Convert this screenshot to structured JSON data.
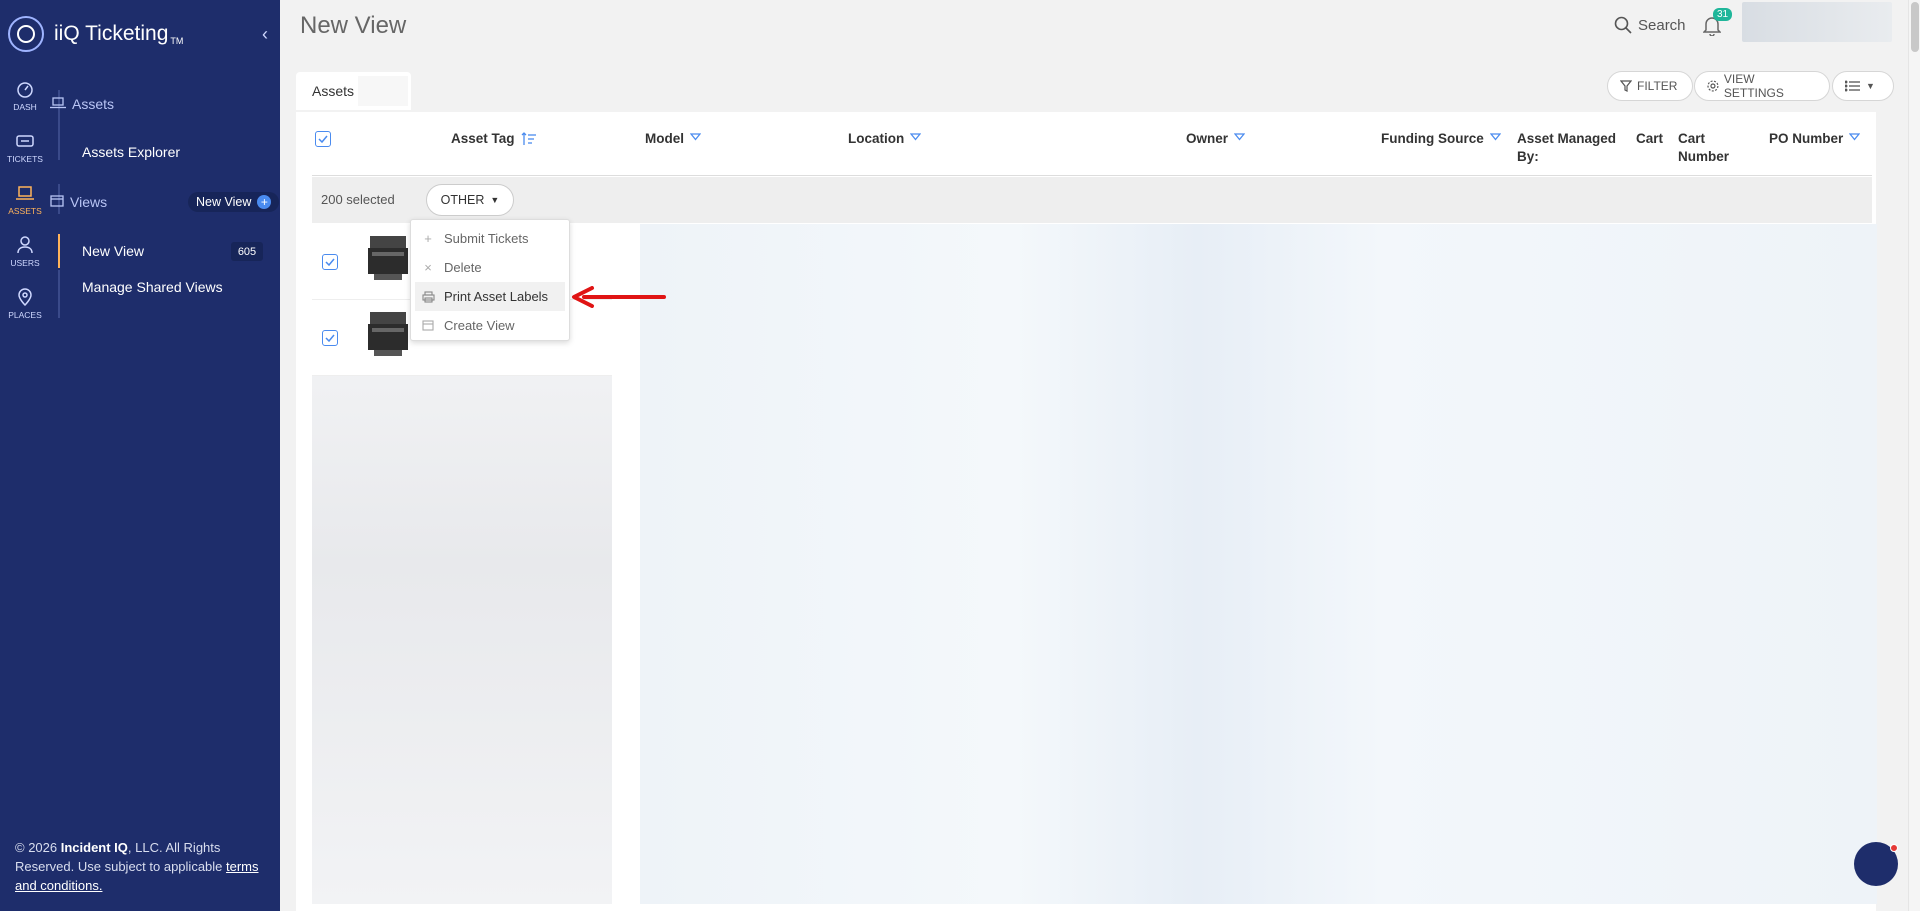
{
  "app": {
    "title": "iiQ Ticketing",
    "tm": "TM"
  },
  "rail": [
    {
      "label": "DASH",
      "icon": "dashboard-icon"
    },
    {
      "label": "TICKETS",
      "icon": "ticket-icon"
    },
    {
      "label": "ASSETS",
      "icon": "laptop-icon"
    },
    {
      "label": "USERS",
      "icon": "user-icon"
    },
    {
      "label": "PLACES",
      "icon": "location-pin-icon"
    }
  ],
  "nav": {
    "assets_section": "Assets",
    "assets_explorer": "Assets Explorer",
    "views_section": "Views",
    "new_view_badge": "New View",
    "new_view_link": "New View",
    "new_view_count": "605",
    "manage_shared": "Manage Shared Views"
  },
  "footer": {
    "pre": "© 2026 ",
    "company": "Incident IQ",
    "post": ", LLC. All Rights Reserved. Use subject to applicable ",
    "terms": "terms and conditions."
  },
  "header": {
    "title": "New View",
    "search": "Search",
    "notifications": "31"
  },
  "tab": {
    "label": "Assets"
  },
  "toolbar": {
    "filter": "FILTER",
    "view_settings": "VIEW SETTINGS"
  },
  "columns": {
    "asset_tag": "Asset Tag",
    "model": "Model",
    "location": "Location",
    "owner": "Owner",
    "funding": "Funding Source",
    "managed_by_1": "Asset Managed",
    "managed_by_2": "By:",
    "cart": "Cart",
    "cart_number_1": "Cart",
    "cart_number_2": "Number",
    "po_number": "PO Number"
  },
  "selection": {
    "text": "200 selected",
    "other": "OTHER"
  },
  "menu": {
    "submit": "Submit Tickets",
    "delete": "Delete",
    "print": "Print Asset Labels",
    "create": "Create View"
  },
  "colors": {
    "sidebar": "#1e2d6b",
    "accent": "#ffb35a",
    "primary": "#4a8bef",
    "arrow": "#e01414"
  }
}
